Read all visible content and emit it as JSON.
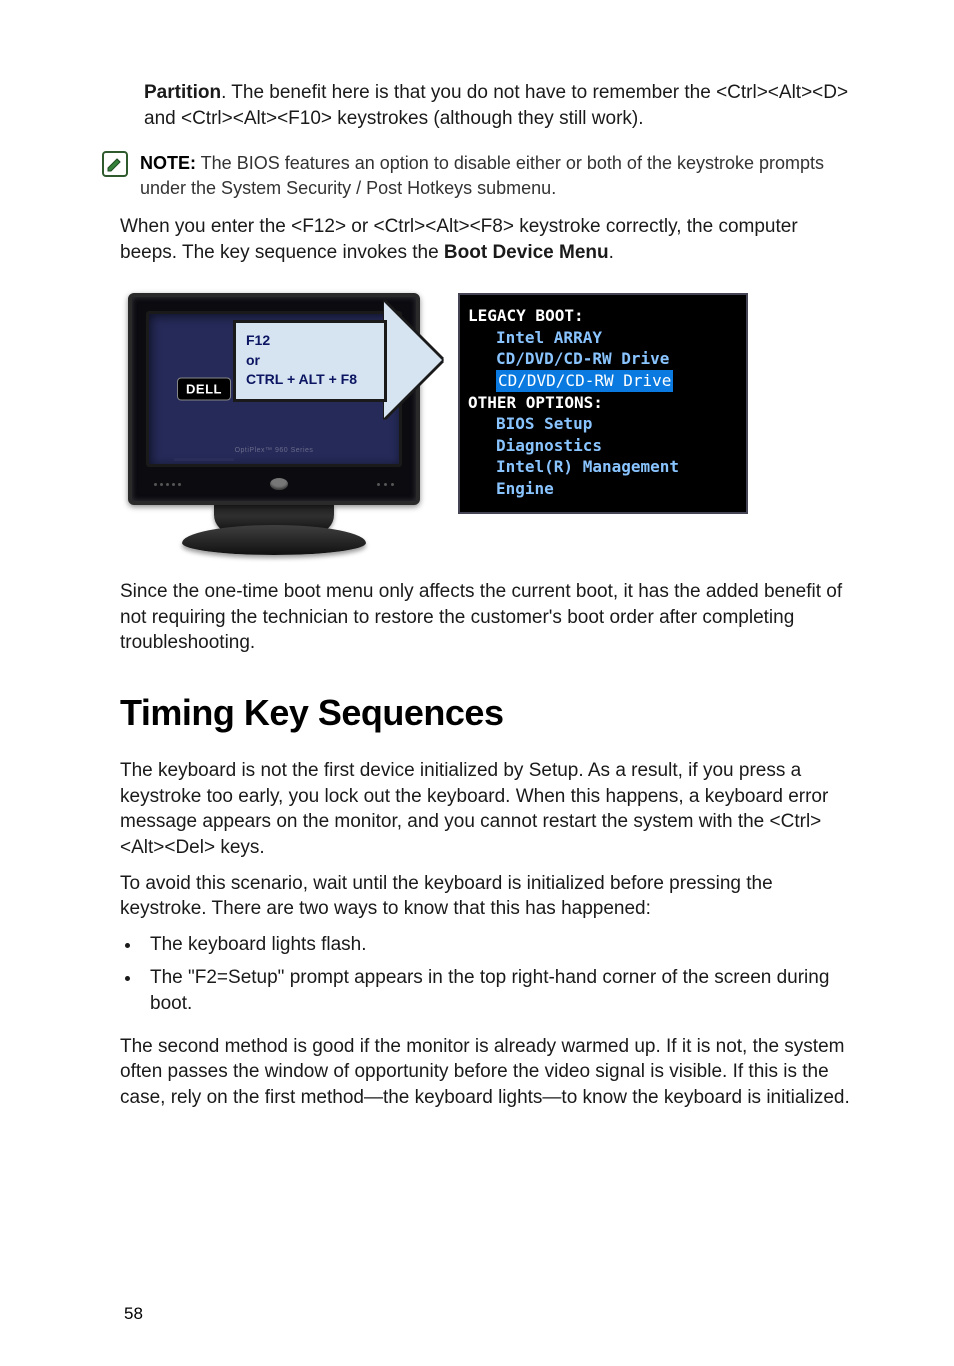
{
  "intro": {
    "partition_label": "Partition",
    "p1_tail": ". The benefit here is that you do not have to remember the <Ctrl><Alt><D> and <Ctrl><Alt><F10> keystrokes (although they still work)."
  },
  "note": {
    "icon": "note-pencil-icon",
    "label": "NOTE:",
    "text": " The BIOS features an option to disable either or both of the keystroke prompts under the System Security / Post Hotkeys submenu."
  },
  "p2_pre": "When you enter the <F12> or <Ctrl><Alt><F8> keystroke correctly, the computer beeps. The key sequence invokes the ",
  "p2_bold": "Boot Device Menu",
  "p2_post": ".",
  "figure": {
    "monitor": {
      "brand": "DELL",
      "model_line": "OptiPlex™ 960 Series"
    },
    "arrow": {
      "line1": "F12",
      "line2": "or",
      "line3": "CTRL + ALT + F8"
    },
    "boot_menu": {
      "legacy_label": "LEGACY BOOT:",
      "legacy_items": [
        "Intel ARRAY",
        "CD/DVD/CD-RW Drive",
        "CD/DVD/CD-RW Drive"
      ],
      "selected_index": 2,
      "other_label": "OTHER OPTIONS:",
      "other_items": [
        "BIOS Setup",
        "Diagnostics",
        "Intel(R) Management Engine"
      ]
    }
  },
  "p3": "Since the one-time boot menu only affects the current boot, it has the added benefit of not requiring the technician to restore the customer's boot order after completing troubleshooting.",
  "heading2": "Timing Key Sequences",
  "p4": "The keyboard is not the first device initialized by Setup. As a result, if you press a keystroke too early, you lock out the keyboard. When this happens, a keyboard error message appears on the monitor, and you cannot restart the system with the <Ctrl><Alt><Del> keys.",
  "p5": "To avoid this scenario, wait until the keyboard is initialized before pressing the keystroke. There are two ways to know that this has happened:",
  "bullets": [
    "The keyboard lights flash.",
    "The \"F2=Setup\" prompt appears in the top right-hand corner of the screen during boot."
  ],
  "p6": "The second method is good if the monitor is already warmed up. If it is not, the system often passes the window of opportunity before the video signal is visible. If this is the case, rely on the first method—the keyboard lights—to know the keyboard is initialized.",
  "page_number": "58"
}
